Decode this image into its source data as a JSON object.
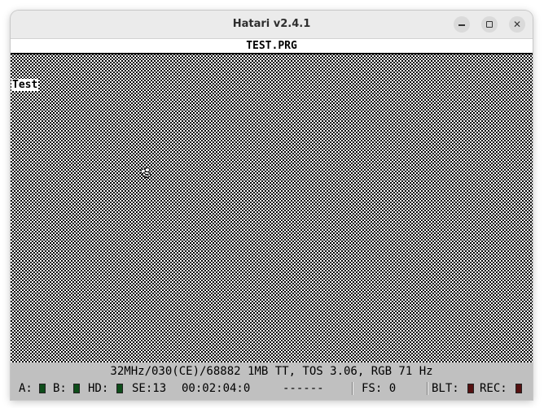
{
  "window": {
    "title": "Hatari v2.4.1",
    "controls": {
      "minimize_icon": "minimize-icon",
      "maximize_icon": "maximize-icon",
      "close_glyph": "✕"
    }
  },
  "emulator": {
    "menubar_title": "TEST.PRG",
    "desktop_text": "Test",
    "pointer_icon": "busy-bee-icon"
  },
  "statusbar": {
    "info": "32MHz/030(CE)/68882 1MB TT, TOS 3.06, RGB 71 Hz",
    "drive_a_label": "A:",
    "drive_b_label": "B:",
    "hd_label": "HD:",
    "se_value": "SE:13",
    "time_value": "00:02:04:0",
    "dashes": "------",
    "fs_value": "FS: 0",
    "blt_label": "BLT:",
    "rec_label": "REC:",
    "led_colors": {
      "drive": "#0e4d1a",
      "blitter": "#551111",
      "record": "#551111"
    }
  },
  "colors": {
    "screen_foreground": "#000000",
    "screen_background": "#ffffff",
    "statusbar_background": "#c0c0c0"
  }
}
